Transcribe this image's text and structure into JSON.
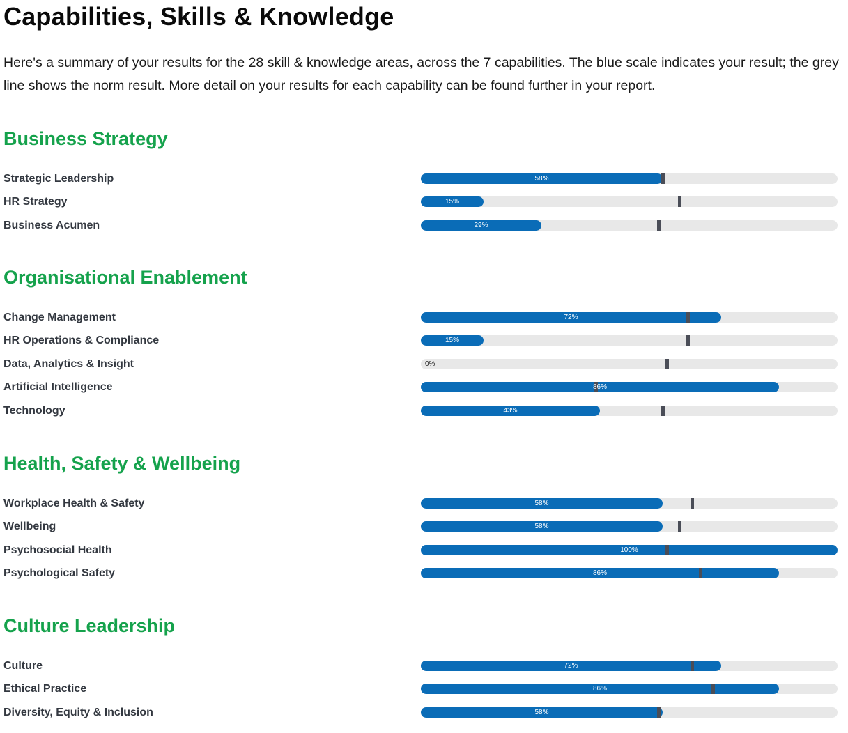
{
  "page": {
    "title": "Capabilities, Skills & Knowledge",
    "intro": "Here's a summary of your results for the 28 skill & knowledge areas, across the 7 capabilities. The blue scale indicates your result; the grey line shows the norm result. More detail on your results for each capability can be found further in your report."
  },
  "colors": {
    "section_title": "#15a24c",
    "result_bar": "#0a6cb7",
    "track": "#e8e8e8",
    "norm_marker": "#4a4d57"
  },
  "chart_data": {
    "type": "bar",
    "orientation": "horizontal",
    "scale": [
      0,
      100
    ],
    "unit": "%",
    "groups": [
      {
        "title": "Business Strategy",
        "items": [
          {
            "label": "Strategic Leadership",
            "value": 58,
            "value_label": "58%",
            "norm": 58
          },
          {
            "label": "HR Strategy",
            "value": 15,
            "value_label": "15%",
            "norm": 62
          },
          {
            "label": "Business Acumen",
            "value": 29,
            "value_label": "29%",
            "norm": 57
          }
        ]
      },
      {
        "title": "Organisational Enablement",
        "items": [
          {
            "label": "Change Management",
            "value": 72,
            "value_label": "72%",
            "norm": 64
          },
          {
            "label": "HR Operations & Compliance",
            "value": 15,
            "value_label": "15%",
            "norm": 64
          },
          {
            "label": "Data, Analytics & Insight",
            "value": 0,
            "value_label": "0%",
            "norm": 59
          },
          {
            "label": "Artificial Intelligence",
            "value": 86,
            "value_label": "86%",
            "norm": 42
          },
          {
            "label": "Technology",
            "value": 43,
            "value_label": "43%",
            "norm": 58
          }
        ]
      },
      {
        "title": "Health, Safety & Wellbeing",
        "items": [
          {
            "label": "Workplace Health & Safety",
            "value": 58,
            "value_label": "58%",
            "norm": 65
          },
          {
            "label": "Wellbeing",
            "value": 58,
            "value_label": "58%",
            "norm": 62
          },
          {
            "label": "Psychosocial Health",
            "value": 100,
            "value_label": "100%",
            "norm": 59
          },
          {
            "label": "Psychological Safety",
            "value": 86,
            "value_label": "86%",
            "norm": 67
          }
        ]
      },
      {
        "title": "Culture Leadership",
        "items": [
          {
            "label": "Culture",
            "value": 72,
            "value_label": "72%",
            "norm": 65
          },
          {
            "label": "Ethical Practice",
            "value": 86,
            "value_label": "86%",
            "norm": 70
          },
          {
            "label": "Diversity, Equity & Inclusion",
            "value": 58,
            "value_label": "58%",
            "norm": 57
          }
        ]
      }
    ]
  }
}
